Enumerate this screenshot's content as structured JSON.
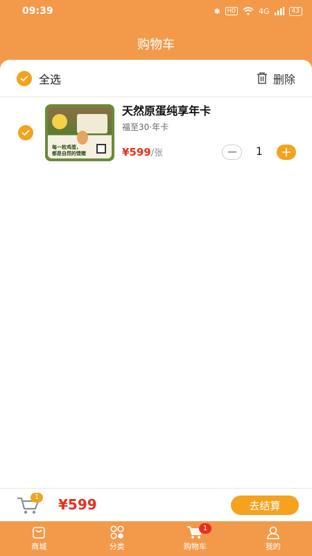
{
  "status": {
    "time": "09:39",
    "hd": "HD",
    "network": "4G",
    "battery": "43"
  },
  "header": {
    "title": "购物车"
  },
  "toolbar": {
    "select_all_label": "全选",
    "delete_label": "删除"
  },
  "cart_item": {
    "title": "天然原蛋纯享年卡",
    "subtitle": "福至30·年卡",
    "price": "¥599",
    "unit": "/张",
    "quantity": "1",
    "image_caption_line1": "每一枚鸡蛋，",
    "image_caption_line2": "都是自然的馈赠"
  },
  "checkout": {
    "cart_count": "1",
    "total": "¥599",
    "button_label": "去结算"
  },
  "tabbar": {
    "items": [
      {
        "label": "商城",
        "icon": "shop-icon"
      },
      {
        "label": "分类",
        "icon": "category-icon"
      },
      {
        "label": "购物车",
        "icon": "cart-icon",
        "badge": "1"
      },
      {
        "label": "我的",
        "icon": "user-icon"
      }
    ]
  },
  "colors": {
    "brand": "#f29a4a",
    "accent": "#f5a21e",
    "price": "#e6301f"
  }
}
